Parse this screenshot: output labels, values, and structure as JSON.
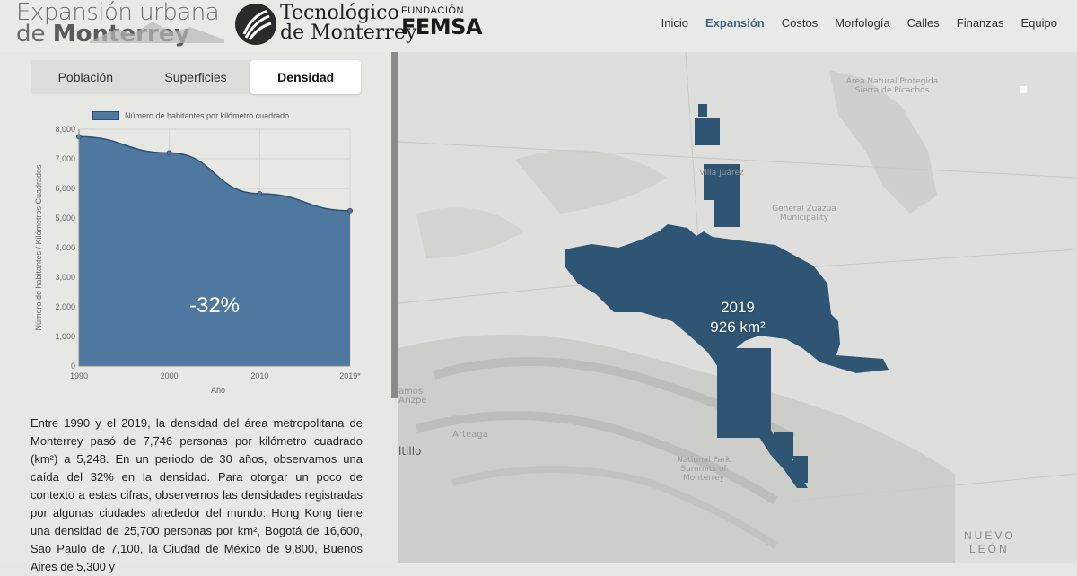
{
  "header": {
    "logo_line1": "Expansión urbana",
    "logo_line2_prefix": "de",
    "logo_line2_bold": "Monterrey",
    "tec_line1": "Tecnológico",
    "tec_line2": "de Monterrey",
    "femsa_top": "FUNDACIÓN",
    "femsa_name": "FEMSA"
  },
  "nav": {
    "items": [
      "Inicio",
      "Expansión",
      "Costos",
      "Morfología",
      "Calles",
      "Finanzas",
      "Equipo"
    ],
    "active": "Expansión"
  },
  "tabs": {
    "items": [
      "Población",
      "Superficies",
      "Densidad"
    ],
    "active": "Densidad"
  },
  "chart_data": {
    "type": "area",
    "legend": "Número de habitantes por kilómetro cuadrado",
    "x": [
      "1990",
      "2000",
      "2010",
      "2019*"
    ],
    "values": [
      7746,
      7200,
      5820,
      5248
    ],
    "ylabel": "Número de habitantes / Kilómetros Cuadrados",
    "xlabel": "Año",
    "ylim": [
      0,
      8000
    ],
    "yticks": [
      "0",
      "1,000",
      "2,000",
      "3,000",
      "4,000",
      "5,000",
      "6,000",
      "7,000",
      "8,000"
    ],
    "annotation": "-32%",
    "color": "#4f78a1",
    "grid": true
  },
  "paragraph": "Entre 1990 y el 2019, la densidad del área metropolitana de Monterrey pasó de 7,746 personas por kilómetro cuadrado (km²) a 5,248. En un periodo de 30 años, observamos una caída del 32% en la densidad. Para otorgar un poco de contexto a estas cifras, observemos las densidades registradas por algunas ciudades alrededor del mundo: Hong Kong tiene una densidad de 25,700 personas por km², Bogotá de 16,600, Sao Paulo de 7,100, la Ciudad de México de 9,800, Buenos Aires de 5,300 y",
  "map": {
    "year": "2019",
    "area": "926 km²",
    "footprint_color": "#2e5574",
    "places": {
      "picachos": "Área Natural Protegida Sierra de Picachos",
      "villa": "Villa Juárez",
      "zuazua": "General Zuazua Municipality",
      "ramos": "amos Arizpe",
      "arteaga": "Arteaga",
      "saltillo": "ltillo",
      "park": "National Park Summits of Monterrey",
      "nuevo": "NUEVO",
      "leon": "LEÓN"
    }
  }
}
